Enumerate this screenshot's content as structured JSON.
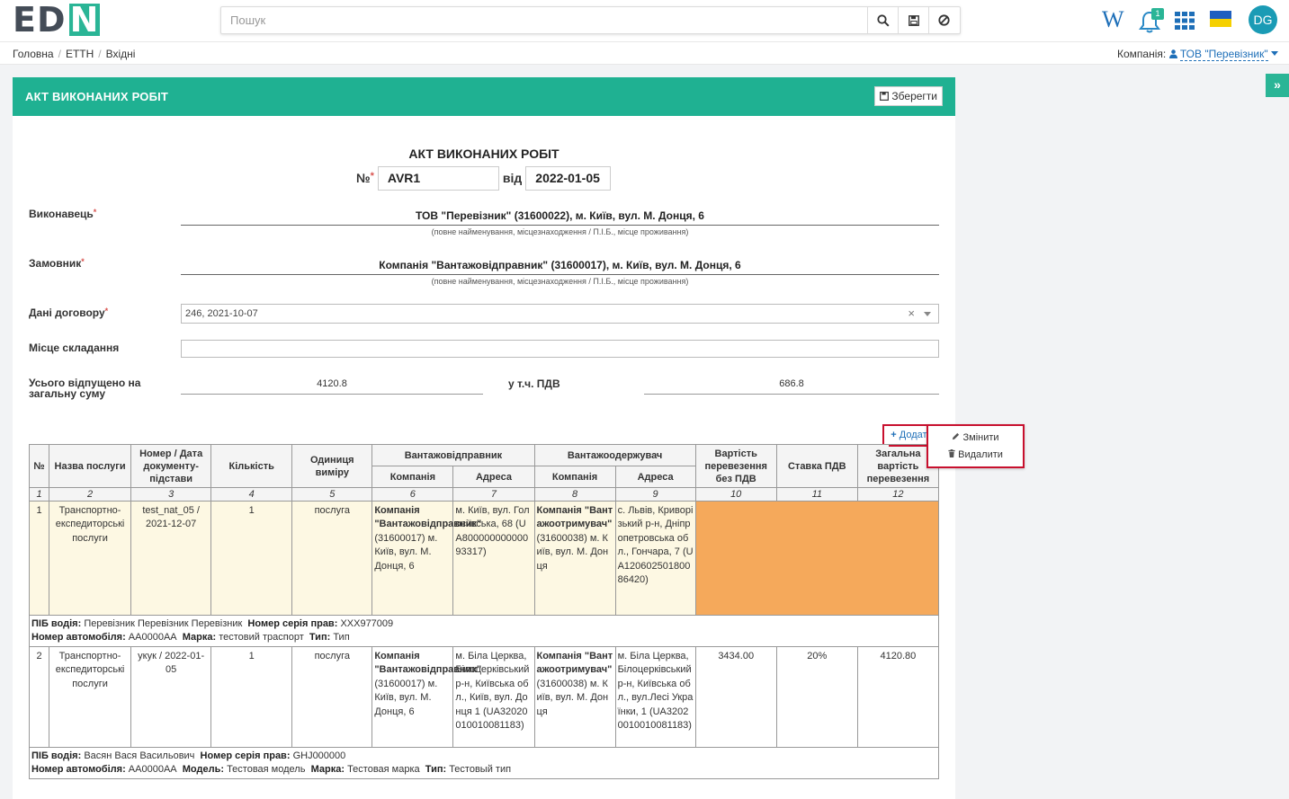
{
  "header": {
    "logo_text": "ED",
    "logo_accent": "N",
    "search_placeholder": "Пошук",
    "notification_count": "1",
    "wiki_icon": "W",
    "avatar_initials": "DG",
    "brand_color": "#1fb192"
  },
  "breadcrumb": {
    "items": [
      "Головна",
      "ЕТТН",
      "Вхідні"
    ],
    "company_label": "Компанія:",
    "company_name": "ТОВ \"Перевізник\""
  },
  "panel": {
    "title": "АКТ ВИКОНАНИХ РОБІТ",
    "save_label": "Зберегти"
  },
  "document": {
    "title": "АКТ ВИКОНАНИХ РОБІТ",
    "number_label": "№",
    "number_value": "AVR1",
    "date_label": "від",
    "date_value": "2022-01-05",
    "executor_label": "Виконавець",
    "executor_value": "ТОВ \"Перевізник\" (31600022), м. Київ, вул. М. Донця, 6",
    "customer_label": "Замовник",
    "customer_value": "Компанія \"Вантажовідправник\" (31600017), м. Київ, вул. М. Донця, 6",
    "hint": "(повне найменування, місцезнаходження / П.І.Б., місце проживання)",
    "contract_label": "Дані договору",
    "contract_value": "246, 2021-10-07",
    "place_label": "Місце складання",
    "place_value": "",
    "total_label_1": "Усього відпущено на",
    "total_label_2": "загальну суму",
    "total_value": "4120.8",
    "vat_label": "у т.ч. ПДВ",
    "vat_value": "686.8",
    "add_label": "Додати"
  },
  "table": {
    "headers": {
      "num": "№",
      "service": "Назва послуги",
      "doc": "Номер / Дата документу-підстави",
      "qty": "Кількість",
      "unit": "Одиниця виміру",
      "shipper": "Вантажовідправник",
      "consignee": "Вантажоодержувач",
      "company": "Компанія",
      "address": "Адреса",
      "cost": "Вартість перевезення без ПДВ",
      "vat_rate": "Ставка ПДВ",
      "total": "Загальна вартість перевезення"
    },
    "col_numbers": [
      "1",
      "2",
      "3",
      "4",
      "5",
      "6",
      "7",
      "8",
      "9",
      "10",
      "11",
      "12"
    ],
    "rows": [
      {
        "num": "1",
        "service": "Транспортно-експедиторські послуги",
        "doc": "test_nat_05 / 2021-12-07",
        "qty": "1",
        "unit": "послуга",
        "ship_company_name": "Компанія \"Вантажовідправник\"",
        "ship_company_rest": "(31600017) м. Київ, вул. М. Донця, 6",
        "ship_address": "м. Київ, вул. Голосіївська, 68 (UA80000000000093317)",
        "cons_company_name": "Компанія \"Вантажоотримувач\"",
        "cons_company_rest": "(31600038) м. Київ, вул. М. Донця",
        "cons_address": "с. Львів, Криворізький р-н, Дніпропетровська обл., Гончара, 7 (UA12060250180086420)",
        "cost": "",
        "vat_rate": "",
        "total": "",
        "driver_label": "ПІБ водія:",
        "driver": "Перевізник Перевізник Перевізник",
        "license_label": "Номер серія прав:",
        "license": "ХХХ977009",
        "plate_label": "Номер автомобіля:",
        "plate": "АА0000АА",
        "brand_label": "Марка:",
        "brand": "тестовий трaспорт",
        "type_label": "Тип:",
        "type": "Тип"
      },
      {
        "num": "2",
        "service": "Транспортно-експедиторські послуги",
        "doc": "укук / 2022-01-05",
        "qty": "1",
        "unit": "послуга",
        "ship_company_name": "Компанія \"Вантажовідправник\"",
        "ship_company_rest": "(31600017) м. Київ, вул. М. Донця, 6",
        "ship_address": "м. Біла Церква, Білоцерківський р-н, Київська обл., Київ, вул. Донця 1 (UA32020010010081183)",
        "cons_company_name": "Компанія \"Вантажоотримувач\"",
        "cons_company_rest": "(31600038) м. Київ, вул. М. Донця",
        "cons_address": "м. Біла Церква, Білоцерківський р-н, Київська обл., вул.Лесі Українки, 1 (UA32020010010081183)",
        "cost": "3434.00",
        "vat_rate": "20%",
        "total": "4120.80",
        "driver_label": "ПІБ водія:",
        "driver": "Васян Вася Васильович",
        "license_label": "Номер серія прав:",
        "license": "GHJ000000",
        "plate_label": "Номер автомобіля:",
        "plate": "АА0000АА",
        "model_label": "Модель:",
        "model": "Тестовая модель",
        "brand_label": "Марка:",
        "brand": "Тестовая марка",
        "type_label": "Тип:",
        "type": "Тестовый тип"
      }
    ]
  },
  "row_menu": {
    "edit_label": "Змінити",
    "delete_label": "Видалити"
  }
}
